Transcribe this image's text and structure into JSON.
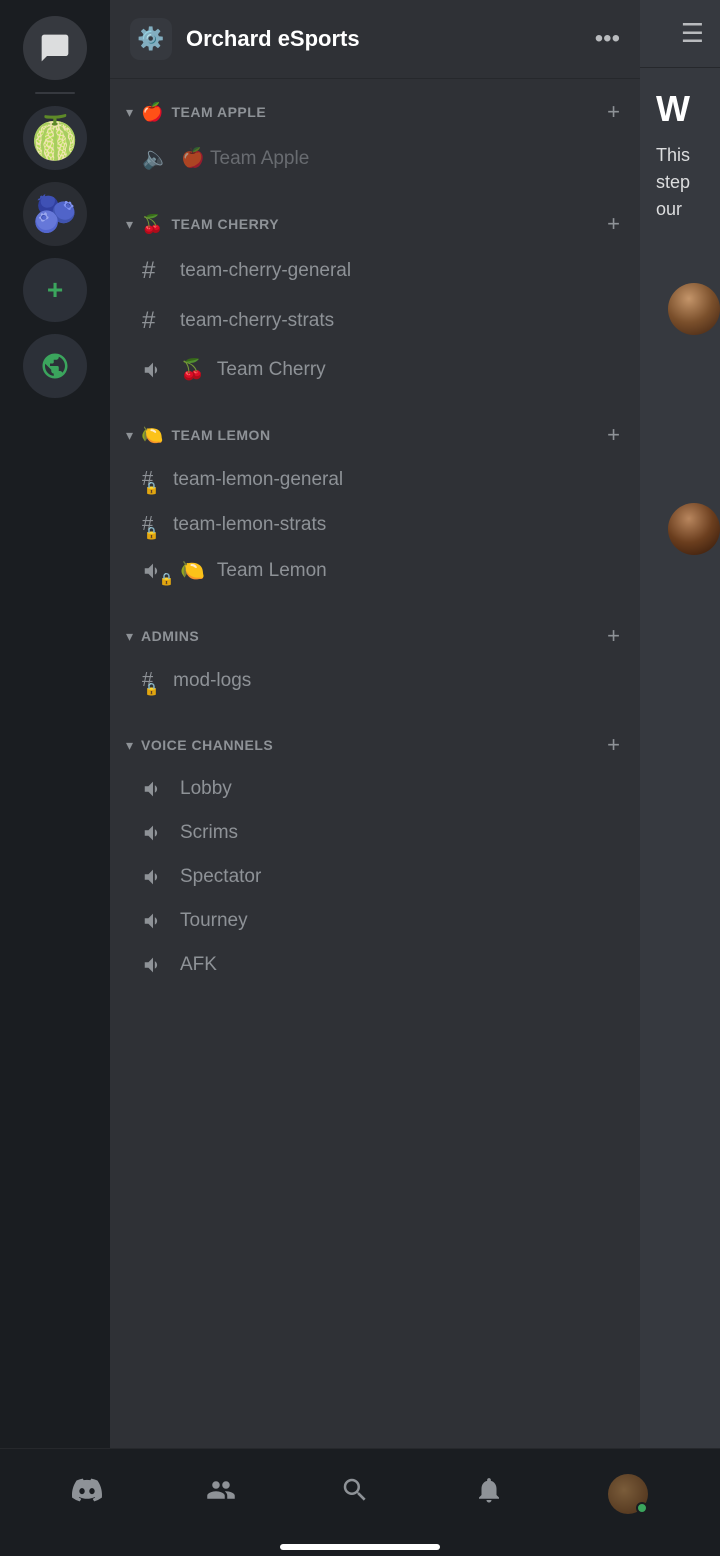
{
  "server": {
    "name": "Orchard eSports",
    "icon": "⚙️"
  },
  "categories": [
    {
      "id": "team-apple",
      "name": "TEAM APPLE",
      "emoji": "🍎",
      "channels": [
        {
          "id": "team-apple-partial",
          "type": "voice-partial",
          "name": "Team Apple",
          "emoji": "🍎"
        }
      ]
    },
    {
      "id": "team-cherry",
      "name": "TEAM CHERRY",
      "emoji": "🍒",
      "channels": [
        {
          "id": "team-cherry-general",
          "type": "text",
          "name": "team-cherry-general",
          "locked": false
        },
        {
          "id": "team-cherry-strats",
          "type": "text",
          "name": "team-cherry-strats",
          "locked": false
        },
        {
          "id": "team-cherry-voice",
          "type": "voice",
          "name": "Team Cherry",
          "emoji": "🍒"
        }
      ]
    },
    {
      "id": "team-lemon",
      "name": "TEAM LEMON",
      "emoji": "🍋",
      "channels": [
        {
          "id": "team-lemon-general",
          "type": "text",
          "name": "team-lemon-general",
          "locked": true
        },
        {
          "id": "team-lemon-strats",
          "type": "text",
          "name": "team-lemon-strats",
          "locked": true
        },
        {
          "id": "team-lemon-voice",
          "type": "voice",
          "name": "Team Lemon",
          "emoji": "🍋"
        }
      ]
    },
    {
      "id": "admins",
      "name": "ADMINS",
      "emoji": "",
      "channels": [
        {
          "id": "mod-logs",
          "type": "text",
          "name": "mod-logs",
          "locked": true
        }
      ]
    },
    {
      "id": "voice-channels",
      "name": "VOICE CHANNELS",
      "emoji": "",
      "channels": [
        {
          "id": "lobby",
          "type": "voice",
          "name": "Lobby",
          "emoji": ""
        },
        {
          "id": "scrims",
          "type": "voice",
          "name": "Scrims",
          "emoji": ""
        },
        {
          "id": "spectator",
          "type": "voice",
          "name": "Spectator",
          "emoji": ""
        },
        {
          "id": "tourney",
          "type": "voice",
          "name": "Tourney",
          "emoji": ""
        },
        {
          "id": "afk",
          "type": "voice",
          "name": "AFK",
          "emoji": ""
        }
      ]
    }
  ],
  "rightPanel": {
    "headerText": "W",
    "bodyText": "This step our"
  },
  "bottomNav": {
    "items": [
      {
        "id": "discord-home",
        "icon": "discord",
        "label": "Home"
      },
      {
        "id": "friends",
        "icon": "friends",
        "label": "Friends"
      },
      {
        "id": "search",
        "icon": "search",
        "label": "Search"
      },
      {
        "id": "notifications",
        "icon": "bell",
        "label": "Notifications"
      },
      {
        "id": "profile",
        "icon": "avatar",
        "label": "Profile"
      }
    ]
  }
}
